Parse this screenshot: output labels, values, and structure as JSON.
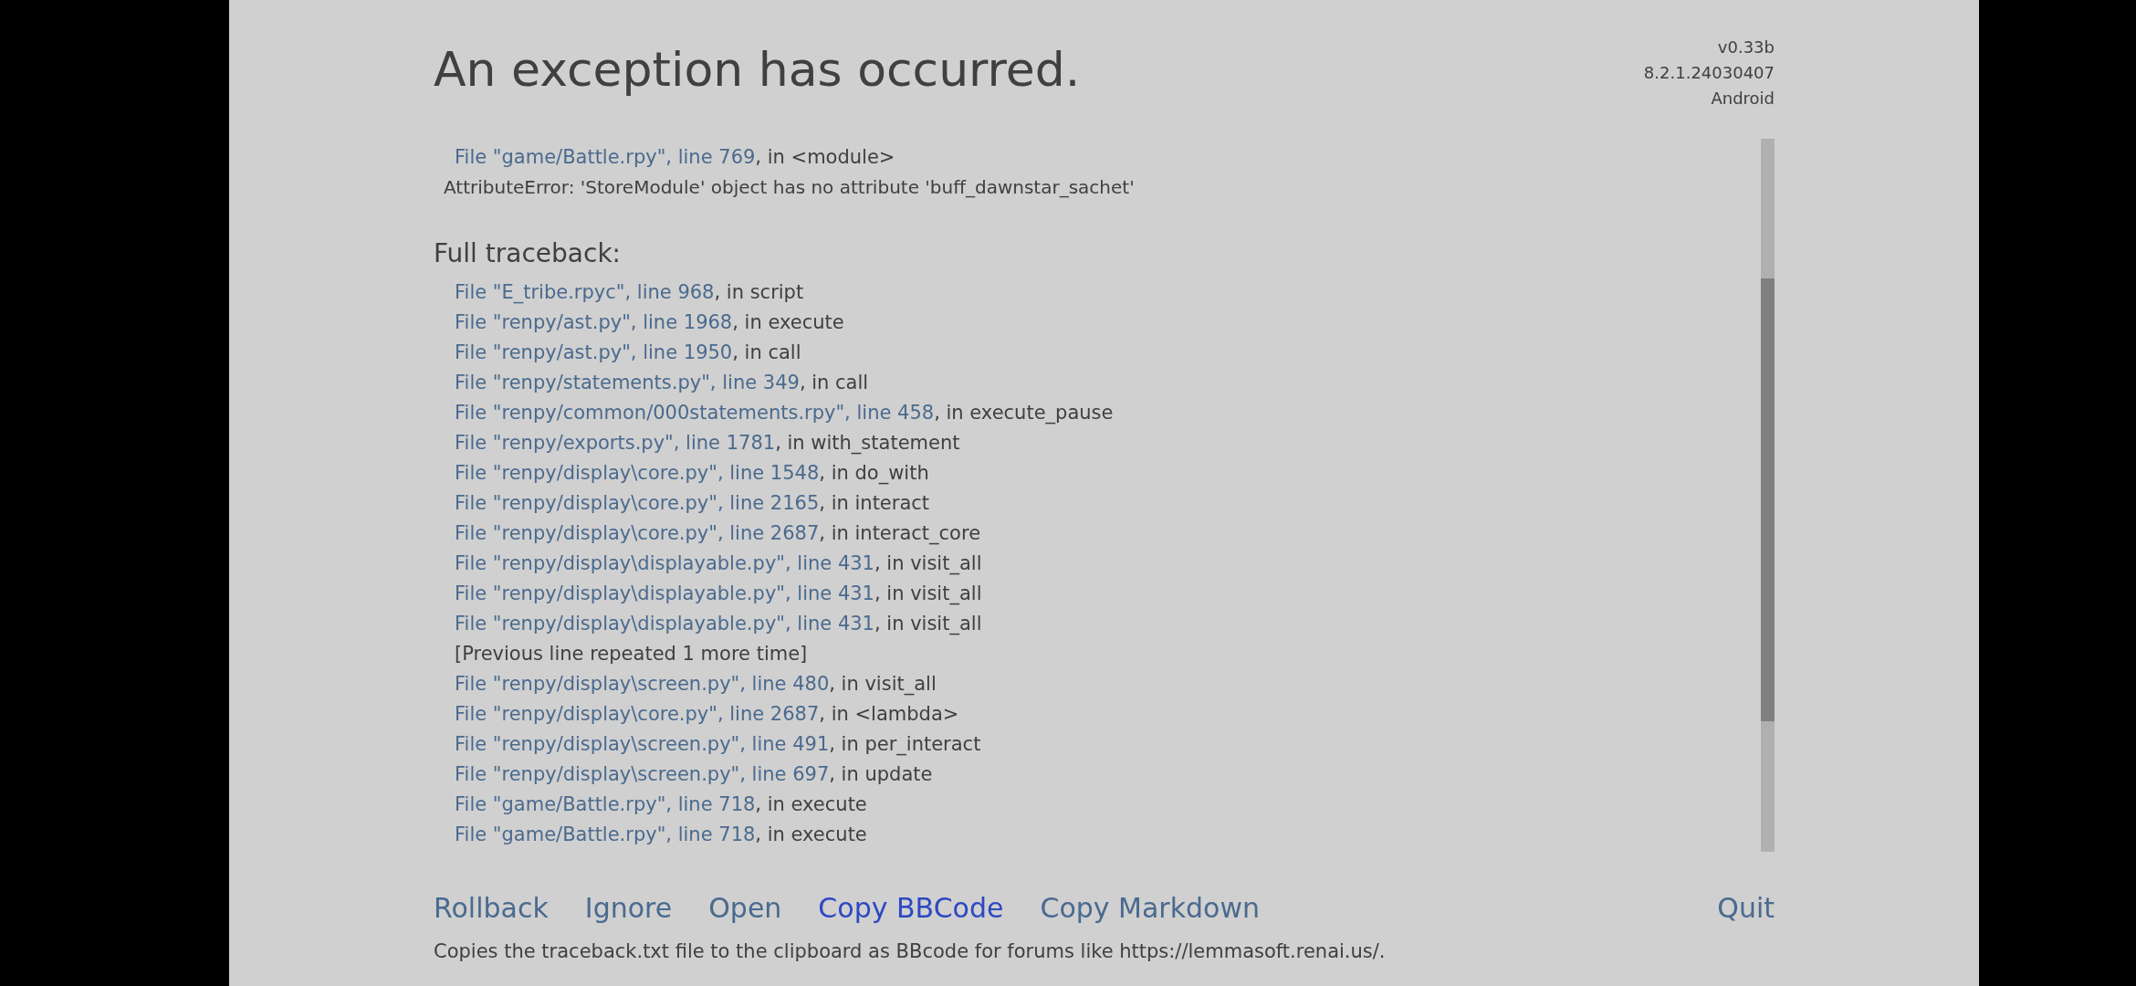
{
  "header": {
    "title": "An exception has occurred.",
    "version_info": [
      "v0.33b",
      "8.2.1.24030407",
      "Android"
    ]
  },
  "exception": {
    "frames": [
      {
        "kind": "frame",
        "link": "File \"game/Battle.rpy\", line 769",
        "text": ", in <module>"
      }
    ],
    "error": "AttributeError: 'StoreModule' object has no attribute 'buff_dawnstar_sachet'"
  },
  "full_traceback": {
    "heading": "Full traceback:",
    "lines": [
      {
        "kind": "frame",
        "link": "File \"E_tribe.rpyc\", line 968",
        "text": ", in script"
      },
      {
        "kind": "frame",
        "link": "File \"renpy/ast.py\", line 1968",
        "text": ", in execute"
      },
      {
        "kind": "frame",
        "link": "File \"renpy/ast.py\", line 1950",
        "text": ", in call"
      },
      {
        "kind": "frame",
        "link": "File \"renpy/statements.py\", line 349",
        "text": ", in call"
      },
      {
        "kind": "frame",
        "link": "File \"renpy/common/000statements.rpy\", line 458",
        "text": ", in execute_pause"
      },
      {
        "kind": "frame",
        "link": "File \"renpy/exports.py\", line 1781",
        "text": ", in with_statement"
      },
      {
        "kind": "frame",
        "link": "File \"renpy/display\\core.py\", line 1548",
        "text": ", in do_with"
      },
      {
        "kind": "frame",
        "link": "File \"renpy/display\\core.py\", line 2165",
        "text": ", in interact"
      },
      {
        "kind": "frame",
        "link": "File \"renpy/display\\core.py\", line 2687",
        "text": ", in interact_core"
      },
      {
        "kind": "frame",
        "link": "File \"renpy/display\\displayable.py\", line 431",
        "text": ", in visit_all"
      },
      {
        "kind": "frame",
        "link": "File \"renpy/display\\displayable.py\", line 431",
        "text": ", in visit_all"
      },
      {
        "kind": "frame",
        "link": "File \"renpy/display\\displayable.py\", line 431",
        "text": ", in visit_all"
      },
      {
        "kind": "note",
        "text": "[Previous line repeated 1 more time]"
      },
      {
        "kind": "frame",
        "link": "File \"renpy/display\\screen.py\", line 480",
        "text": ", in visit_all"
      },
      {
        "kind": "frame",
        "link": "File \"renpy/display\\core.py\", line 2687",
        "text": ", in <lambda>"
      },
      {
        "kind": "frame",
        "link": "File \"renpy/display\\screen.py\", line 491",
        "text": ", in per_interact"
      },
      {
        "kind": "frame",
        "link": "File \"renpy/display\\screen.py\", line 697",
        "text": ", in update"
      },
      {
        "kind": "frame",
        "link": "File \"game/Battle.rpy\", line 718",
        "text": ", in execute"
      },
      {
        "kind": "frame",
        "link": "File \"game/Battle.rpy\", line 718",
        "text": ", in execute"
      }
    ]
  },
  "actions": [
    {
      "label": "Rollback",
      "selected": false
    },
    {
      "label": "Ignore",
      "selected": false
    },
    {
      "label": "Open",
      "selected": false
    },
    {
      "label": "Copy BBCode",
      "selected": true
    },
    {
      "label": "Copy Markdown",
      "selected": false
    }
  ],
  "quit": {
    "label": "Quit",
    "selected": false
  },
  "help_text": "Copies the traceback.txt file to the clipboard as BBcode for forums like https://lemmasoft.renai.us/."
}
